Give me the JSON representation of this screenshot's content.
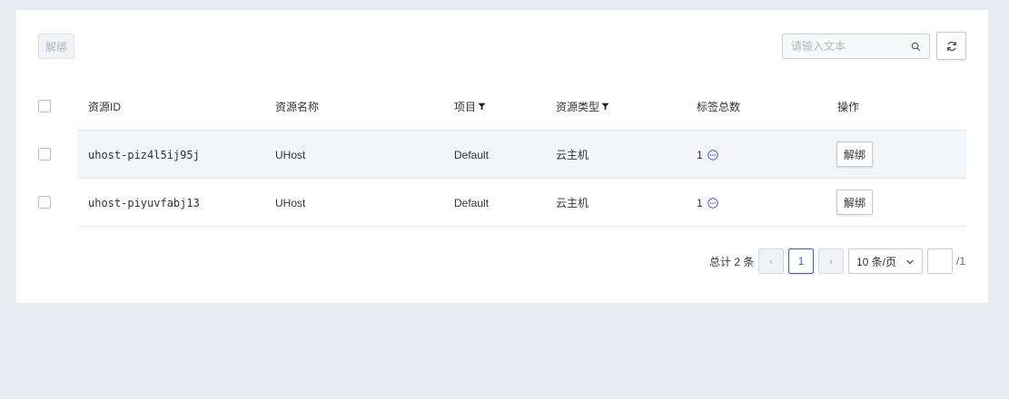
{
  "toolbar": {
    "unbind_label": "解绑",
    "search_placeholder": "请输入文本",
    "search_value": ""
  },
  "table": {
    "columns": {
      "resource_id": "资源ID",
      "resource_name": "资源名称",
      "project": "项目",
      "resource_type": "资源类型",
      "tag_count": "标签总数",
      "actions": "操作"
    },
    "rows": [
      {
        "resource_id": "uhost-piz4l5ij95j",
        "resource_name": "UHost",
        "project": "Default",
        "resource_type": "云主机",
        "tag_count": "1",
        "action_label": "解绑"
      },
      {
        "resource_id": "uhost-piyuvfabj13",
        "resource_name": "UHost",
        "project": "Default",
        "resource_type": "云主机",
        "tag_count": "1",
        "action_label": "解绑"
      }
    ]
  },
  "pagination": {
    "total_text": "总计 2 条",
    "prev_symbol": "‹",
    "next_symbol": "›",
    "current_page": "1",
    "page_size": "10 条/页",
    "jump_value": "",
    "page_count_text": "/1"
  },
  "colors": {
    "accent": "#3b5fd9",
    "background": "#e9ebf3",
    "row_highlight": "#f4f5f8"
  },
  "icons": {
    "search": "search-icon",
    "refresh": "refresh-icon",
    "filter": "filter-icon",
    "more": "more-icon",
    "chevron": "chevron-down-icon"
  }
}
